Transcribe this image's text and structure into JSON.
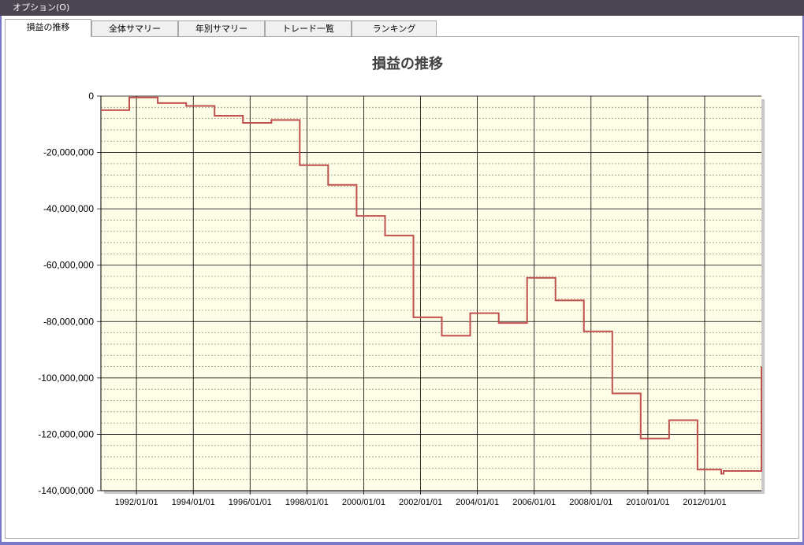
{
  "menu": {
    "options_label": "オプション(O)"
  },
  "tabs": [
    {
      "label": "損益の推移",
      "active": true
    },
    {
      "label": "全体サマリー",
      "active": false
    },
    {
      "label": "年別サマリー",
      "active": false
    },
    {
      "label": "トレード一覧",
      "active": false
    },
    {
      "label": "ランキング",
      "active": false
    }
  ],
  "colors": {
    "plot_bg": "#fdfde8",
    "line": "#c0504d",
    "grid_major": "#000000",
    "grid_minor": "#9a9a7a"
  },
  "chart_data": {
    "type": "line",
    "step": true,
    "title": "損益の推移",
    "xlabel": "",
    "ylabel": "",
    "ylim": [
      -140000000,
      0
    ],
    "y_tick_values": [
      0,
      -20000000,
      -40000000,
      -60000000,
      -80000000,
      -100000000,
      -120000000,
      -140000000
    ],
    "y_tick_labels": [
      "0",
      "-20,000,000",
      "-40,000,000",
      "-60,000,000",
      "-80,000,000",
      "-100,000,000",
      "-120,000,000",
      "-140,000,000"
    ],
    "xlim": [
      "1990/10/01",
      "2013/12/31"
    ],
    "x_tick_values": [
      "1992/01/01",
      "1994/01/01",
      "1996/01/01",
      "1998/01/01",
      "2000/01/01",
      "2002/01/01",
      "2004/01/01",
      "2006/01/01",
      "2008/01/01",
      "2010/01/01",
      "2012/01/01"
    ],
    "x_tick_labels": [
      "1992/01/01",
      "1994/01/01",
      "1996/01/01",
      "1998/01/01",
      "2000/01/01",
      "2002/01/01",
      "2004/01/01",
      "2006/01/01",
      "2008/01/01",
      "2010/01/01",
      "2012/01/01"
    ],
    "grid": true,
    "series": [
      {
        "x": [
          "1990/10/01",
          "1991/10/01",
          "1992/10/01",
          "1993/10/01",
          "1994/10/01",
          "1995/10/01",
          "1996/10/01",
          "1997/10/01",
          "1998/10/01",
          "1999/10/01",
          "2000/10/01",
          "2001/10/01",
          "2002/10/01",
          "2003/10/01",
          "2004/10/01",
          "2005/10/01",
          "2006/10/01",
          "2007/10/01",
          "2008/10/01",
          "2009/10/01",
          "2010/10/01",
          "2011/10/01",
          "2012/08/01",
          "2012/09/01",
          "2013/12/31"
        ],
        "y": [
          -5000000,
          -500000,
          -2500000,
          -3500000,
          -7000000,
          -9500000,
          -8500000,
          -24500000,
          -31500000,
          -42500000,
          -49500000,
          -78500000,
          -85000000,
          -77000000,
          -80500000,
          -64500000,
          -72500000,
          -83500000,
          -105500000,
          -121500000,
          -115000000,
          -132500000,
          -134000000,
          -133000000,
          -96000000
        ]
      }
    ]
  }
}
